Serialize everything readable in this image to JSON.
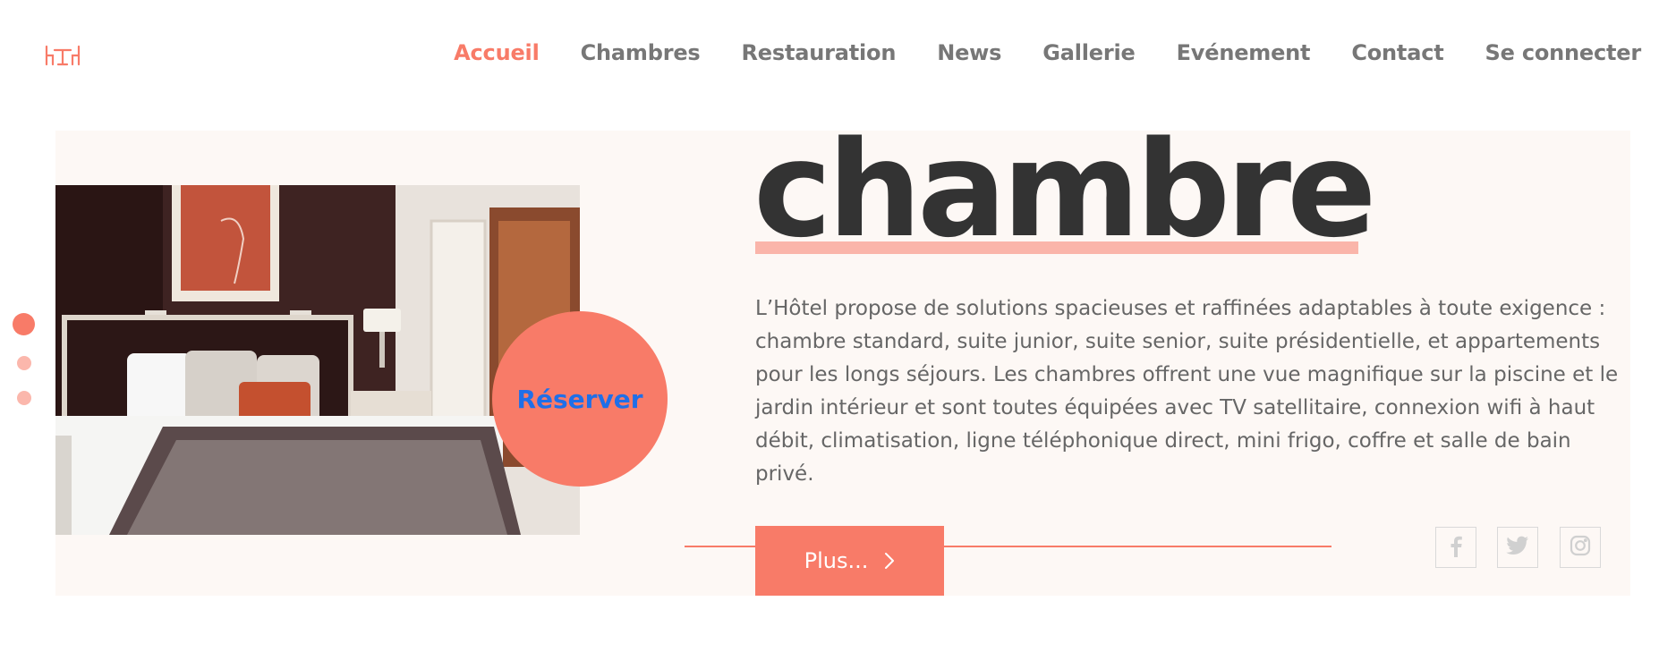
{
  "nav": {
    "items": [
      {
        "label": "Accueil",
        "active": true
      },
      {
        "label": "Chambres",
        "active": false
      },
      {
        "label": "Restauration",
        "active": false
      },
      {
        "label": "News",
        "active": false
      },
      {
        "label": "Gallerie",
        "active": false
      },
      {
        "label": "Evénement",
        "active": false
      },
      {
        "label": "Contact",
        "active": false
      },
      {
        "label": "Se connecter",
        "active": false
      }
    ]
  },
  "hero": {
    "title": "chambre",
    "description": "L’Hôtel propose de solutions spacieuses et raffinées adaptables à toute exigence : chambre standard, suite junior, suite senior, suite présidentielle, et appartements pour les longs séjours. Les chambres offrent une vue magnifique sur la piscine et le jardin intérieur et sont toutes équipées avec TV satellitaire, connexion wifi à haut débit, climatisation, ligne téléphonique direct, mini frigo, coffre et salle de bain privé.",
    "reserve_label": "Réserver",
    "more_label": "Plus..."
  },
  "slider": {
    "count": 3,
    "active_index": 0
  },
  "social": [
    "facebook-icon",
    "twitter-icon",
    "instagram-icon"
  ],
  "colors": {
    "accent": "#f87b68",
    "reserve_text": "#1f6fe8",
    "title": "#333333",
    "body_text": "#666666",
    "nav_text": "#777777",
    "panel_bg": "#fdf8f5",
    "underline": "#fab5aa"
  }
}
